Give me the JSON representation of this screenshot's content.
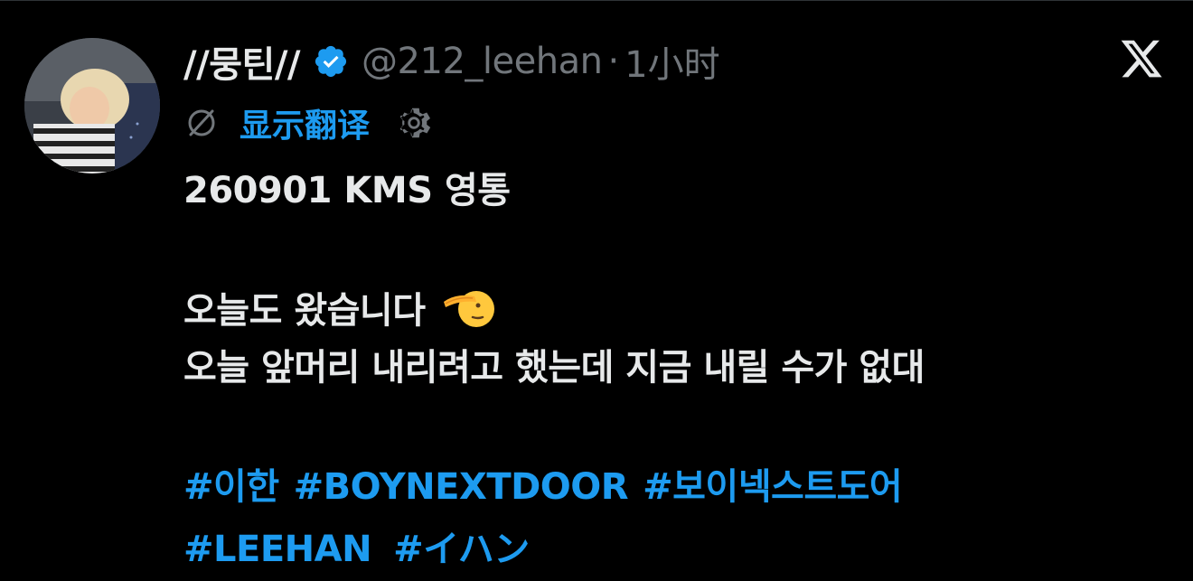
{
  "post": {
    "display_name": "//뭉틴//",
    "handle": "@212_leehan",
    "separator": "·",
    "time": "1小时",
    "translate_label": "显示翻译",
    "lines": [
      "260901 KMS 영통",
      "오늘도 왔습니다",
      "오늘 앞머리 내리려고 했는데 지금 내릴 수가 없대"
    ],
    "hashtags_row1": [
      "#이한",
      "#BOYNEXTDOOR",
      "#보이넥스트도어"
    ],
    "hashtags_row2": [
      "#LEEHAN",
      "#イハン"
    ]
  },
  "icons": {
    "avatar": "avatar",
    "verified": "verified-badge-icon",
    "x": "x-logo-icon",
    "translate": "translate-icon",
    "settings": "gear-icon",
    "emoji": "saluting-face-emoji-icon"
  },
  "colors": {
    "background": "#000000",
    "text": "#e7e9ea",
    "muted": "#71767b",
    "accent": "#1d9bf0"
  }
}
